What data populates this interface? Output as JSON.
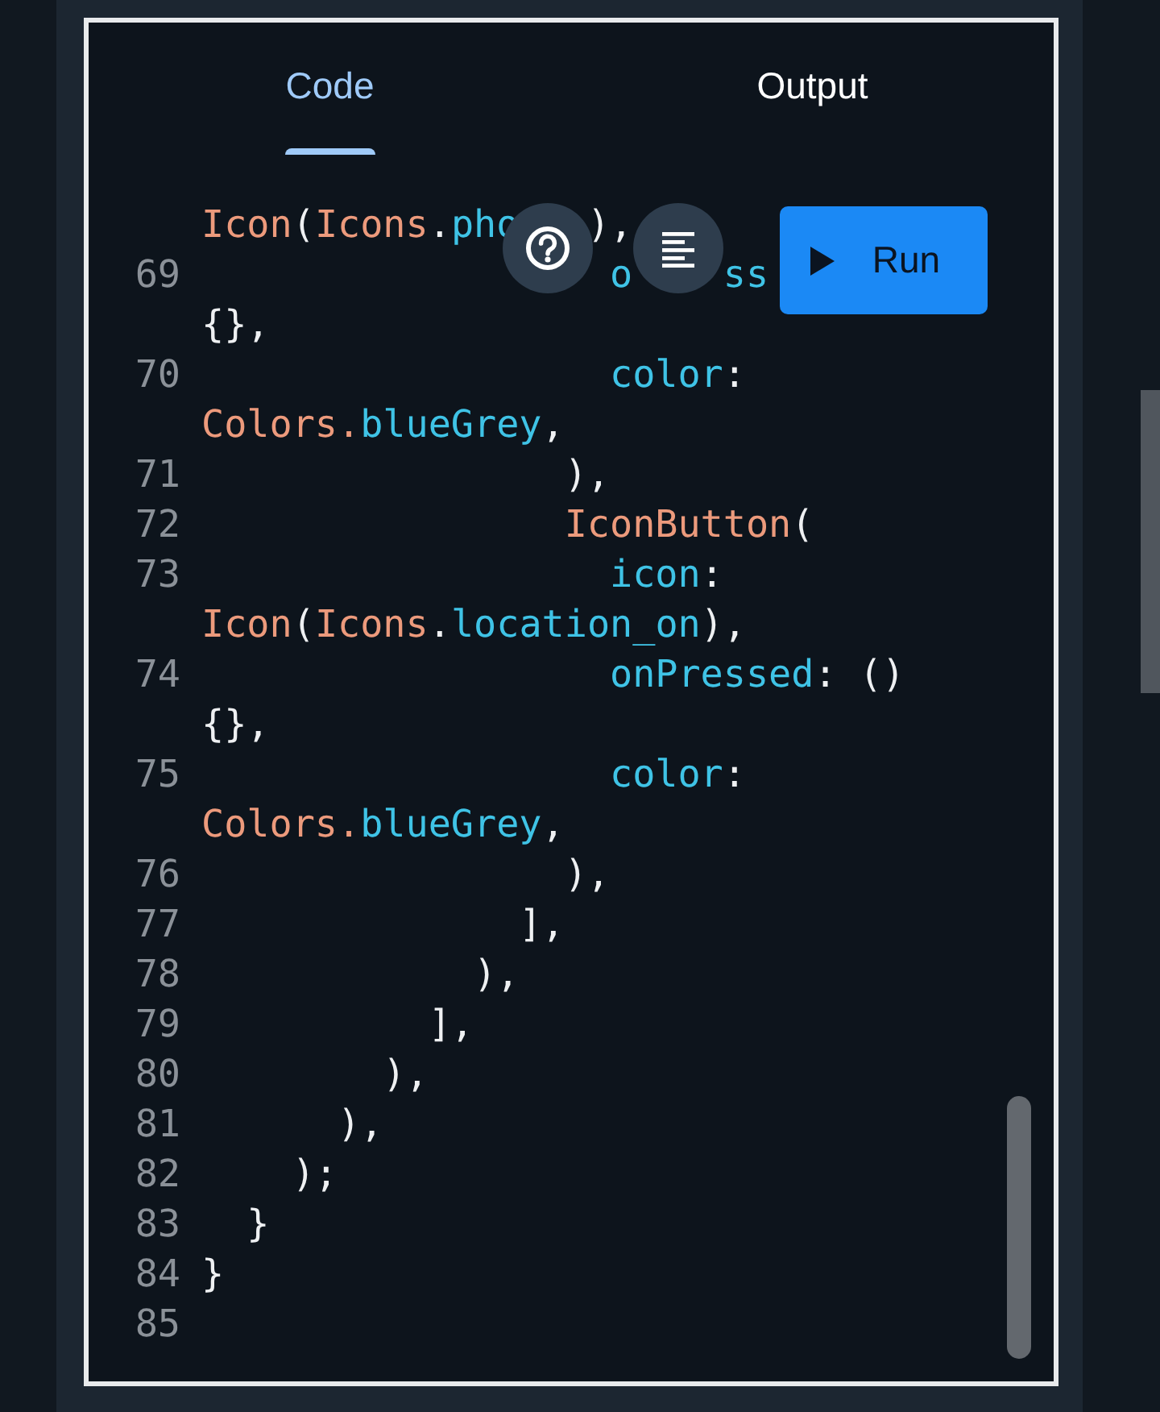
{
  "tabs": [
    {
      "label": "Code",
      "selected": true
    },
    {
      "label": "Output",
      "selected": false
    }
  ],
  "code_lines": [
    {
      "tokens": [
        {
          "kind": "class",
          "text": "Icon"
        },
        {
          "kind": "plain",
          "text": "("
        },
        {
          "kind": "class",
          "text": "Icons"
        },
        {
          "kind": "plain",
          "text": "."
        },
        {
          "kind": "prop",
          "text": "pho"
        },
        {
          "kind": "plain",
          "text": "   ),"
        }
      ]
    },
    {
      "number": "69",
      "tokens": [
        {
          "kind": "prop",
          "text": "                  o"
        },
        {
          "kind": "prop",
          "text": "    ss"
        }
      ]
    },
    {
      "tokens": [
        {
          "kind": "plain",
          "text": "{},"
        }
      ]
    },
    {
      "number": "70",
      "tokens": [
        {
          "kind": "prop",
          "text": "                  color"
        },
        {
          "kind": "plain",
          "text": ":"
        }
      ]
    },
    {
      "tokens": [
        {
          "kind": "class",
          "text": "Colors."
        },
        {
          "kind": "prop",
          "text": "blueGrey"
        },
        {
          "kind": "plain",
          "text": ","
        }
      ]
    },
    {
      "number": "71",
      "tokens": [
        {
          "kind": "plain",
          "text": "                ),"
        }
      ]
    },
    {
      "number": "72",
      "tokens": [
        {
          "kind": "class",
          "text": "                IconButton"
        },
        {
          "kind": "plain",
          "text": "("
        }
      ]
    },
    {
      "number": "73",
      "tokens": [
        {
          "kind": "prop",
          "text": "                  icon"
        },
        {
          "kind": "plain",
          "text": ":"
        }
      ]
    },
    {
      "tokens": [
        {
          "kind": "class",
          "text": "Icon"
        },
        {
          "kind": "plain",
          "text": "("
        },
        {
          "kind": "class",
          "text": "Icons"
        },
        {
          "kind": "plain",
          "text": "."
        },
        {
          "kind": "prop",
          "text": "location_on"
        },
        {
          "kind": "plain",
          "text": "),"
        }
      ]
    },
    {
      "number": "74",
      "tokens": [
        {
          "kind": "prop",
          "text": "                  onPressed"
        },
        {
          "kind": "plain",
          "text": ": ()"
        }
      ]
    },
    {
      "tokens": [
        {
          "kind": "plain",
          "text": "{},"
        }
      ]
    },
    {
      "number": "75",
      "tokens": [
        {
          "kind": "prop",
          "text": "                  color"
        },
        {
          "kind": "plain",
          "text": ":"
        }
      ]
    },
    {
      "tokens": [
        {
          "kind": "class",
          "text": "Colors."
        },
        {
          "kind": "prop",
          "text": "blueGrey"
        },
        {
          "kind": "plain",
          "text": ","
        }
      ]
    },
    {
      "number": "76",
      "tokens": [
        {
          "kind": "plain",
          "text": "                ),"
        }
      ]
    },
    {
      "number": "77",
      "tokens": [
        {
          "kind": "plain",
          "text": "              ],"
        }
      ]
    },
    {
      "number": "78",
      "tokens": [
        {
          "kind": "plain",
          "text": "            ),"
        }
      ]
    },
    {
      "number": "79",
      "tokens": [
        {
          "kind": "plain",
          "text": "          ],"
        }
      ]
    },
    {
      "number": "80",
      "tokens": [
        {
          "kind": "plain",
          "text": "        ),"
        }
      ]
    },
    {
      "number": "81",
      "tokens": [
        {
          "kind": "plain",
          "text": "      ),"
        }
      ]
    },
    {
      "number": "82",
      "tokens": [
        {
          "kind": "plain",
          "text": "    );"
        }
      ]
    },
    {
      "number": "83",
      "tokens": [
        {
          "kind": "plain",
          "text": "  }"
        }
      ]
    },
    {
      "number": "84",
      "tokens": [
        {
          "kind": "plain",
          "text": "}"
        }
      ]
    },
    {
      "number": "85"
    }
  ],
  "run_button": {
    "label": "Run"
  }
}
